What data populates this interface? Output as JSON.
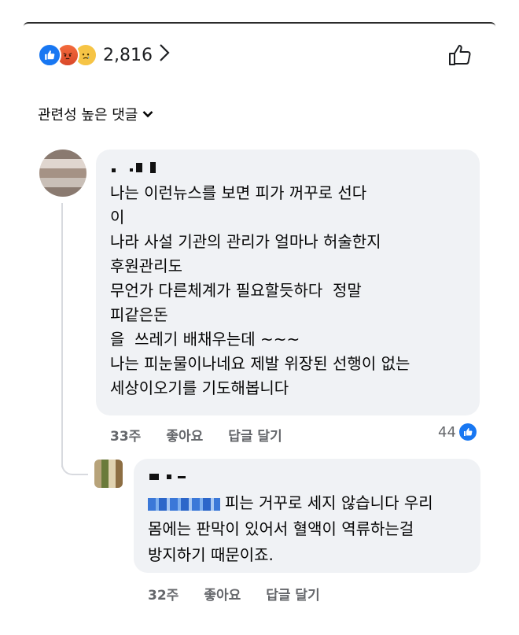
{
  "reactions": {
    "count": "2,816",
    "icons": [
      "like-icon",
      "angry-icon",
      "sad-icon"
    ]
  },
  "sort": {
    "label": "관련성 높은 댓글"
  },
  "comments": [
    {
      "text": "나는 이런뉴스를 보면 피가 꺼꾸로 선다\n이\n나라 사설 기관의 관리가 얼마나 허술한지\n후원관리도\n무언가 다른체계가 필요할듯하다  정말\n피같은돈\n을  쓰레기 배채우는데 ~~~\n나는 피눈물이나네요 제발 위장된 선행이 없는\n세상이오기를 기도해봅니다",
      "time": "33주",
      "like_label": "좋아요",
      "reply_label": "답글 달기",
      "like_count": "44"
    }
  ],
  "reply": {
    "text_line1": "피는 거꾸로 세지 않습니다 우리",
    "text_rest": "몸에는 판막이 있어서 혈액이 역류하는걸\n방지하기 때문이죠.",
    "time": "32주",
    "like_label": "좋아요",
    "reply_label": "답글 달기"
  }
}
